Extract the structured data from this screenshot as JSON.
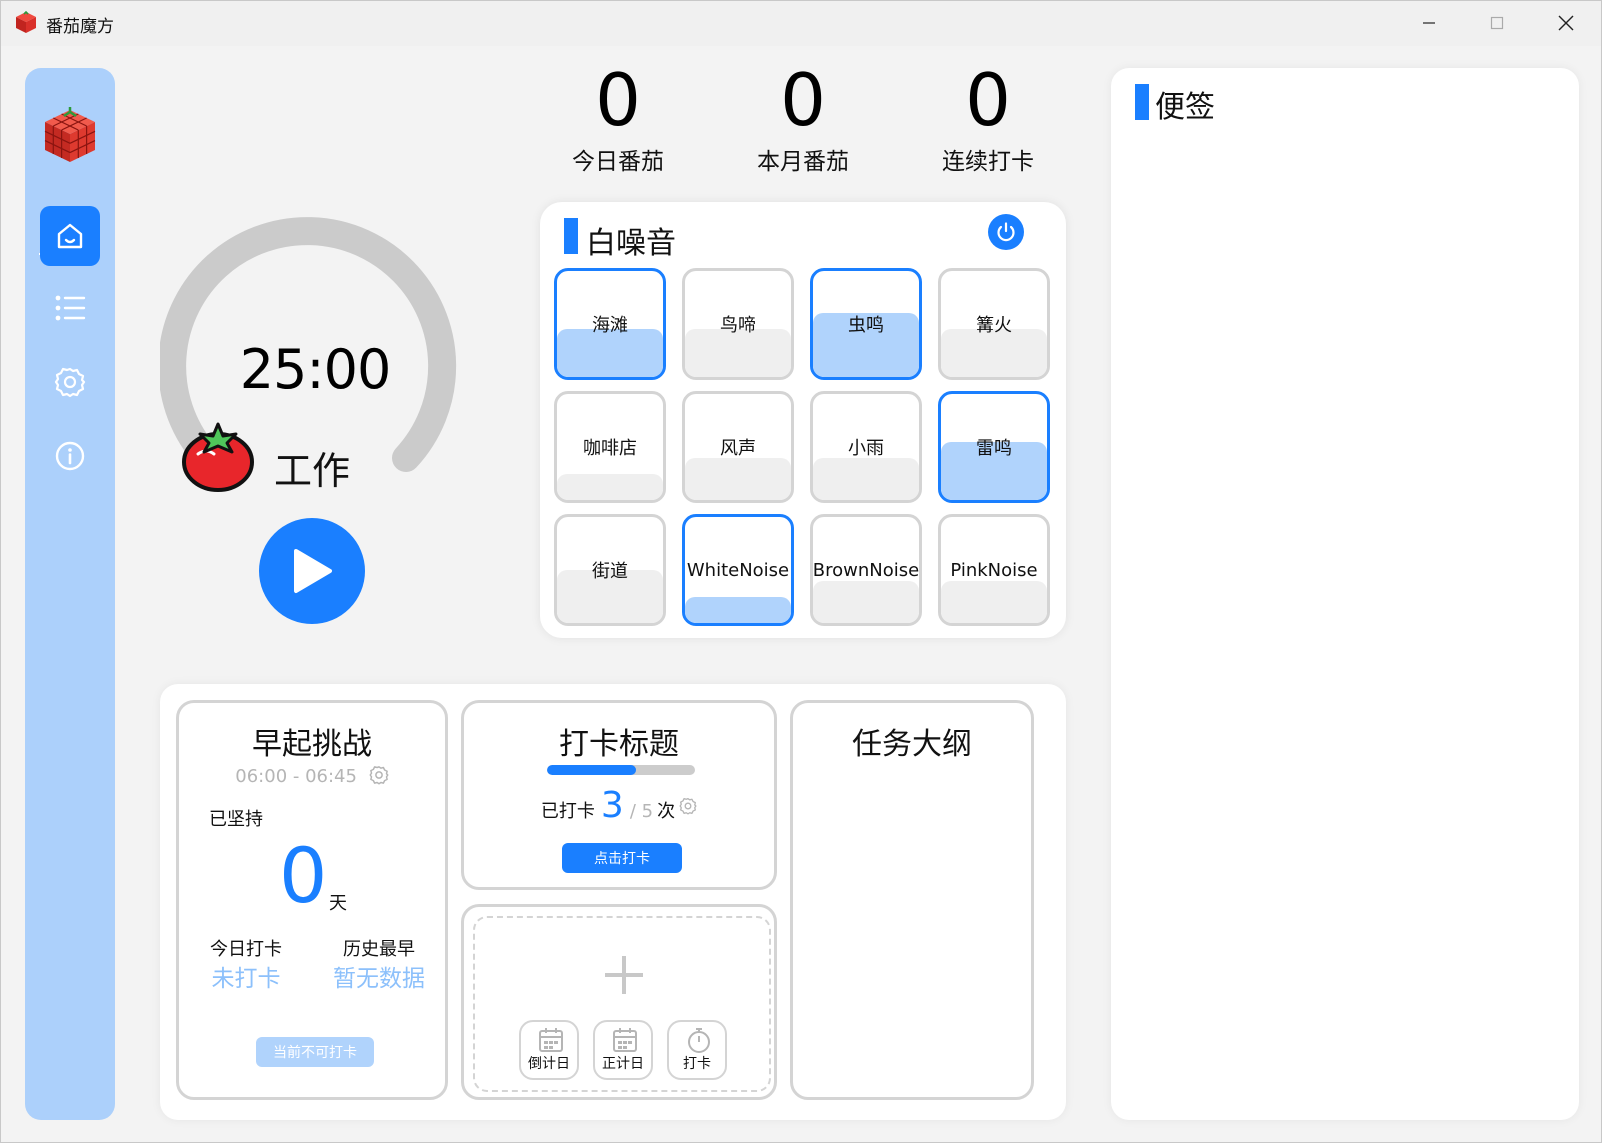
{
  "window": {
    "title": "番茄魔方",
    "controls": [
      "minimize",
      "maximize",
      "close"
    ]
  },
  "sidebar": {
    "logo": "rubik-tomato-logo",
    "items": [
      {
        "icon": "home-icon",
        "active": true
      },
      {
        "icon": "list-icon",
        "active": false
      },
      {
        "icon": "gear-icon",
        "active": false
      },
      {
        "icon": "info-icon",
        "active": false
      }
    ]
  },
  "stats": {
    "today": {
      "value": "0",
      "label": "今日番茄"
    },
    "month": {
      "value": "0",
      "label": "本月番茄"
    },
    "streak": {
      "value": "0",
      "label": "连续打卡"
    }
  },
  "timer": {
    "time": "25:00",
    "mode": "工作",
    "progress": 0.0
  },
  "white_noise": {
    "title": "白噪音",
    "power_icon": "power-icon",
    "tiles": [
      {
        "label": "海滩",
        "on": true,
        "level": 0.45
      },
      {
        "label": "鸟啼",
        "on": false,
        "level": 0.45
      },
      {
        "label": "虫鸣",
        "on": true,
        "level": 0.6
      },
      {
        "label": "篝火",
        "on": false,
        "level": 0.45
      },
      {
        "label": "咖啡店",
        "on": false,
        "level": 0.25
      },
      {
        "label": "风声",
        "on": false,
        "level": 0.4
      },
      {
        "label": "小雨",
        "on": false,
        "level": 0.4
      },
      {
        "label": "雷鸣",
        "on": true,
        "level": 0.55
      },
      {
        "label": "街道",
        "on": false,
        "level": 0.5
      },
      {
        "label": "WhiteNoise",
        "on": true,
        "level": 0.25
      },
      {
        "label": "BrownNoise",
        "on": false,
        "level": 0.4
      },
      {
        "label": "PinkNoise",
        "on": false,
        "level": 0.4
      }
    ]
  },
  "early_challenge": {
    "title": "早起挑战",
    "time_range": "06:00 - 06:45",
    "persist_label": "已坚持",
    "days": "0",
    "days_unit": "天",
    "today_label": "今日打卡",
    "today_value": "未打卡",
    "best_label": "历史最早",
    "best_value": "暂无数据",
    "button": "当前不可打卡"
  },
  "checkin": {
    "title": "打卡标题",
    "progress": 0.6,
    "prefix": "已打卡",
    "count": "3",
    "total": "/ 5",
    "unit": "次",
    "button": "点击打卡"
  },
  "add_widget": {
    "buttons": [
      {
        "label": "倒计日",
        "icon": "calendar-icon"
      },
      {
        "label": "正计日",
        "icon": "calendar-icon"
      },
      {
        "label": "打卡",
        "icon": "stopwatch-icon"
      }
    ]
  },
  "task_outline": {
    "title": "任务大纲"
  },
  "notes": {
    "title": "便签"
  },
  "colors": {
    "accent": "#1a7fff",
    "sidebar": "#acd0fb",
    "tile_on_fill": "#b0d3fc",
    "muted": "#b5b5b5"
  }
}
